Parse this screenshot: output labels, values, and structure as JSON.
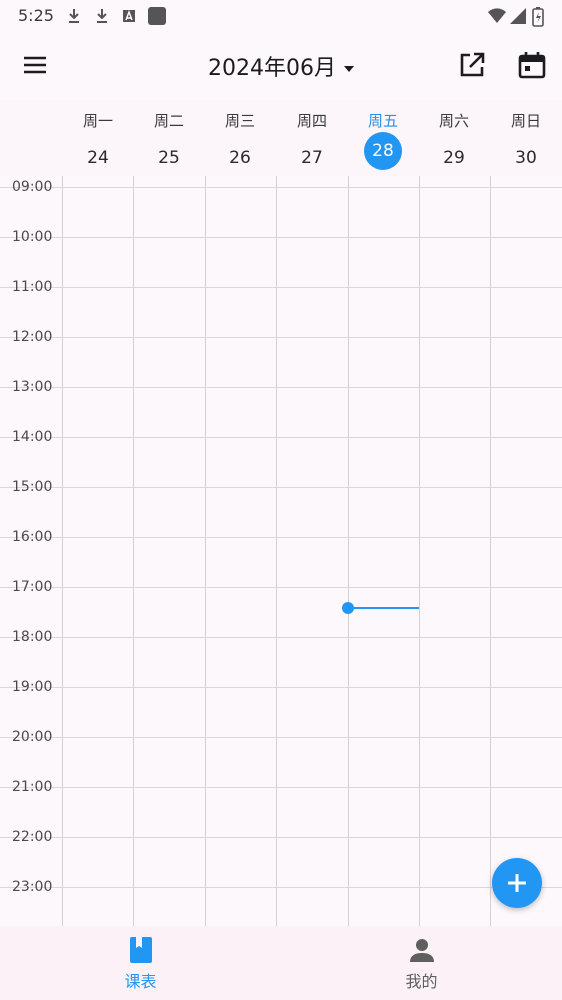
{
  "status_bar": {
    "time": "5:25",
    "icons": [
      "download-icon",
      "download-icon",
      "font-a-icon",
      "app-square-icon",
      "wifi-icon",
      "cell-signal-icon",
      "battery-charging-icon"
    ]
  },
  "app_bar": {
    "title": "2024年06月",
    "menu_icon": "menu-icon",
    "actions": [
      "open-in-new-icon",
      "calendar-icon"
    ]
  },
  "week": {
    "days": [
      {
        "weekday": "周一",
        "date": "24"
      },
      {
        "weekday": "周二",
        "date": "25"
      },
      {
        "weekday": "周三",
        "date": "26"
      },
      {
        "weekday": "周四",
        "date": "27"
      },
      {
        "weekday": "周五",
        "date": "28",
        "today": true
      },
      {
        "weekday": "周六",
        "date": "29"
      },
      {
        "weekday": "周日",
        "date": "30"
      }
    ]
  },
  "timeline": {
    "hours": [
      "09:00",
      "10:00",
      "11:00",
      "12:00",
      "13:00",
      "14:00",
      "15:00",
      "16:00",
      "17:00",
      "18:00",
      "19:00",
      "20:00",
      "21:00",
      "22:00",
      "23:00"
    ],
    "current_time_indicator": {
      "day": "周五",
      "time": "17:25"
    }
  },
  "fab": {
    "icon": "plus-icon"
  },
  "bottom_nav": {
    "items": [
      {
        "label": "课表",
        "icon": "book-icon",
        "active": true
      },
      {
        "label": "我的",
        "icon": "person-icon",
        "active": false
      }
    ]
  },
  "colors": {
    "accent": "#2196f3",
    "background": "#fdf8fb",
    "nav_background": "#fbf1f7",
    "inactive": "#5f5f5f"
  }
}
